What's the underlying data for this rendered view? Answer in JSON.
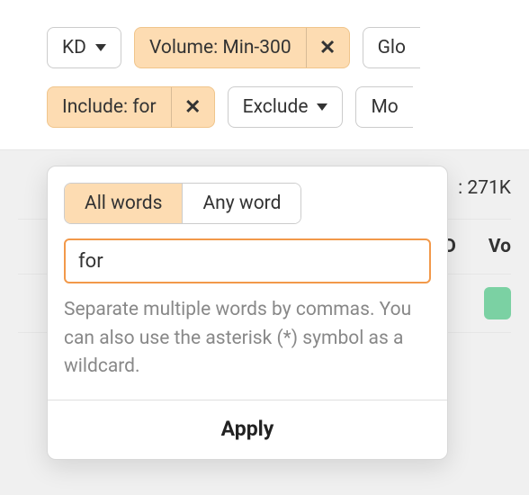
{
  "filters": {
    "kd_label": "KD",
    "volume_label": "Volume: Min-300",
    "global_label": "Glo",
    "include_label": "Include: for",
    "exclude_label": "Exclude",
    "more_label": "Mo"
  },
  "popover": {
    "seg_all": "All words",
    "seg_any": "Any word",
    "input_value": "for",
    "hint": "Separate multiple words by commas. You can also use the asterisk (*) symbol as a wildcard.",
    "apply_label": "Apply"
  },
  "results": {
    "total_suffix": ": 271K",
    "col_d": "D",
    "col_vol": "Vo"
  }
}
